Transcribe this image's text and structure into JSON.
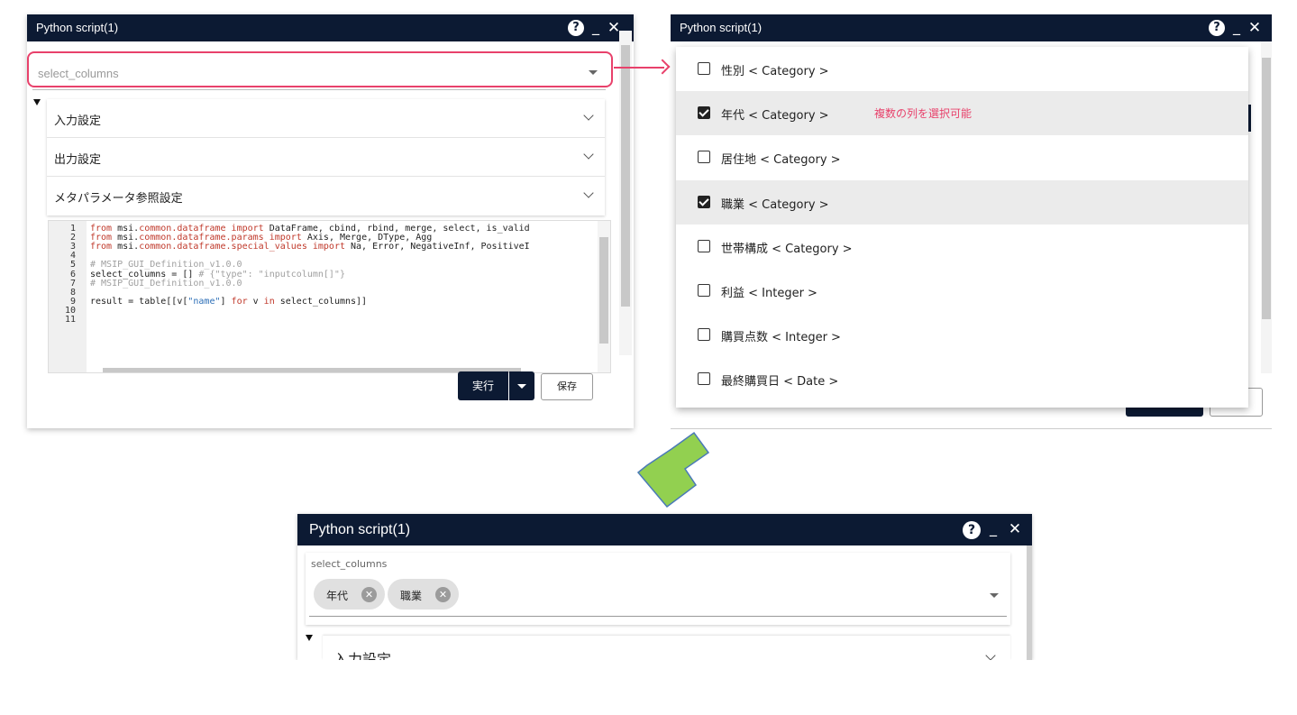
{
  "dialog1": {
    "title": "Python script(1)",
    "select_columns_placeholder": "select_columns",
    "accordion": [
      "入力設定",
      "出力設定",
      "メタパラメータ参照設定"
    ],
    "code": {
      "line_numbers": [
        "1",
        "2",
        "3",
        "4",
        "5",
        "6",
        "7",
        "8",
        "9",
        "10",
        "11"
      ],
      "lines": [
        [
          {
            "t": "from ",
            "c": "kw"
          },
          {
            "t": "msi.",
            "c": ""
          },
          {
            "t": "common.dataframe",
            "c": "kw"
          },
          {
            "t": " import ",
            "c": "kw"
          },
          {
            "t": "DataFrame, cbind, rbind, merge, select, is_valid",
            "c": ""
          }
        ],
        [
          {
            "t": "from ",
            "c": "kw"
          },
          {
            "t": "msi.",
            "c": ""
          },
          {
            "t": "common.dataframe.params",
            "c": "kw"
          },
          {
            "t": " import ",
            "c": "kw"
          },
          {
            "t": "Axis, Merge, DType, Agg",
            "c": ""
          }
        ],
        [
          {
            "t": "from ",
            "c": "kw"
          },
          {
            "t": "msi.",
            "c": ""
          },
          {
            "t": "common.dataframe.special_values",
            "c": "kw"
          },
          {
            "t": " import ",
            "c": "kw"
          },
          {
            "t": "Na, Error, NegativeInf, PositiveI",
            "c": ""
          }
        ],
        [],
        [
          {
            "t": "# MSIP_GUI_Definition_v1.0.0",
            "c": "cm"
          }
        ],
        [
          {
            "t": "select_columns = [] ",
            "c": ""
          },
          {
            "t": "# {\"type\": \"inputcolumn[]\"}",
            "c": "cm"
          }
        ],
        [
          {
            "t": "# MSIP_GUI_Definition_v1.0.0",
            "c": "cm"
          }
        ],
        [],
        [
          {
            "t": "result = table[[v[",
            "c": ""
          },
          {
            "t": "\"name\"",
            "c": "st"
          },
          {
            "t": "] ",
            "c": ""
          },
          {
            "t": "for",
            "c": "kw"
          },
          {
            "t": " v ",
            "c": ""
          },
          {
            "t": "in",
            "c": "kw"
          },
          {
            "t": " select_columns]]",
            "c": ""
          }
        ],
        [],
        []
      ]
    },
    "run_label": "実行",
    "save_label": "保存"
  },
  "dialog2": {
    "title": "Python script(1)",
    "options": [
      {
        "label": "性別 < Category >",
        "checked": false
      },
      {
        "label": "年代 < Category >",
        "checked": true
      },
      {
        "label": "居住地 < Category >",
        "checked": false
      },
      {
        "label": "職業 < Category >",
        "checked": true
      },
      {
        "label": "世帯構成 < Category >",
        "checked": false
      },
      {
        "label": "利益 < Integer >",
        "checked": false
      },
      {
        "label": "購買点数 < Integer >",
        "checked": false
      },
      {
        "label": "最終購買日 < Date >",
        "checked": false
      }
    ],
    "note": "複数の列を選択可能"
  },
  "dialog3": {
    "title": "Python script(1)",
    "field_label": "select_columns",
    "chips": [
      "年代",
      "職業"
    ],
    "accordion_first": "入力設定"
  },
  "colors": {
    "titlebar": "#0c1a33",
    "highlight": "#e8416b",
    "arrow_green": "#92d050"
  },
  "icons": [
    "help-icon",
    "minimize-icon",
    "close-icon",
    "chevron-down-icon",
    "dropdown-caret-icon",
    "checkbox-icon",
    "chip-remove-icon"
  ]
}
